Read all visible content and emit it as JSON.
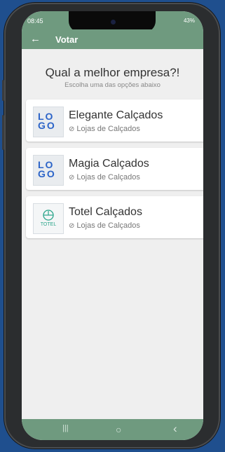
{
  "status": {
    "time": "08:45",
    "right": "43%"
  },
  "appbar": {
    "back_icon": "←",
    "title": "Votar"
  },
  "main": {
    "heading": "Qual a melhor empresa?!",
    "subheading": "Escolha uma das opções abaixo",
    "companies": [
      {
        "name": "Elegante Calçados",
        "category": "Lojas de Calçados",
        "logo_text": "LOGO"
      },
      {
        "name": "Magia Calçados",
        "category": "Lojas de Calçados",
        "logo_text": "LOGO"
      },
      {
        "name": "Totel Calçados",
        "category": "Lojas de Calçados",
        "logo_text": "TOTEL"
      }
    ]
  },
  "navbar": {
    "recent": "|||",
    "home": "○",
    "back": "‹"
  },
  "colors": {
    "accent": "#6f9a7f",
    "logo_blue": "#2c64c8",
    "totel_green": "#2aa58a",
    "background": "#1f4f8e"
  }
}
